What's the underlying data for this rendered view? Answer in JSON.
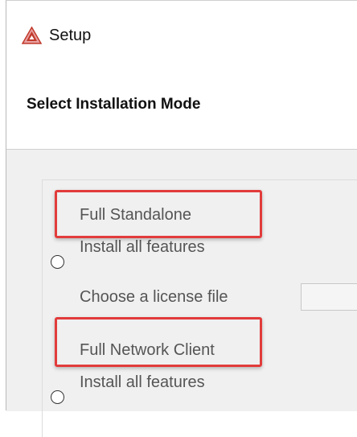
{
  "window": {
    "title": "Setup"
  },
  "header": {
    "heading": "Select Installation Mode"
  },
  "options": [
    {
      "label": "Full Standalone",
      "description": "Install all features",
      "selected": false
    },
    {
      "label": "Full Network Client",
      "description": "Install all features",
      "selected": false
    }
  ],
  "license": {
    "label": "Choose a license file",
    "value": ""
  },
  "colors": {
    "highlight": "#e23b3b",
    "icon_primary": "#c0392b",
    "icon_secondary": "#e8a0a0",
    "body_background": "#f0f0f0"
  },
  "icons": {
    "app": "triangle-logo-icon"
  }
}
